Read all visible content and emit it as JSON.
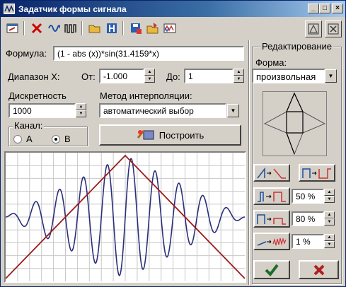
{
  "window": {
    "title": "Задатчик формы сигнала"
  },
  "titlebar_buttons": {
    "minimize": "_",
    "maximize": "□",
    "close": "×"
  },
  "toolbar": {
    "icons": [
      "settings-icon",
      "delete-icon",
      "wave-icon",
      "pulse-icon",
      "open-icon",
      "save-h-icon",
      "save-disk-icon",
      "import-icon",
      "export-icon"
    ]
  },
  "formula": {
    "label": "Формула:",
    "value": "(1 - abs (x))*sin(31.4159*x)"
  },
  "range": {
    "label": "Диапазон X:",
    "from_label": "От:",
    "from_value": "-1.000",
    "to_label": "До:",
    "to_value": "1"
  },
  "discreteness": {
    "label": "Дискретность",
    "value": "1000"
  },
  "interpolation": {
    "label": "Метод интерполяции:",
    "value": "автоматический выбор"
  },
  "channel": {
    "label": "Канал:",
    "options": [
      "A",
      "B"
    ],
    "selected": "B"
  },
  "build_button": {
    "label": "Построить"
  },
  "editing": {
    "title": "Редактирование",
    "shape_label": "Форма:",
    "shape_value": "произвольная",
    "values": [
      "50 %",
      "80 %",
      "1 %"
    ]
  },
  "colors": {
    "signal": "#2b2f7a",
    "envelope": "#9c1b1b",
    "grid": "#c8c8c8"
  },
  "chart_data": {
    "type": "line",
    "xlim": [
      -1,
      1
    ],
    "ylim": [
      -1,
      1
    ],
    "grid": true,
    "series": [
      {
        "formula": "(1-abs(x))*sin(31.4159*x)",
        "x_range": [
          -1,
          1
        ]
      },
      {
        "x": [
          -1,
          0,
          1
        ],
        "y": [
          -1,
          1,
          -1
        ]
      }
    ]
  }
}
